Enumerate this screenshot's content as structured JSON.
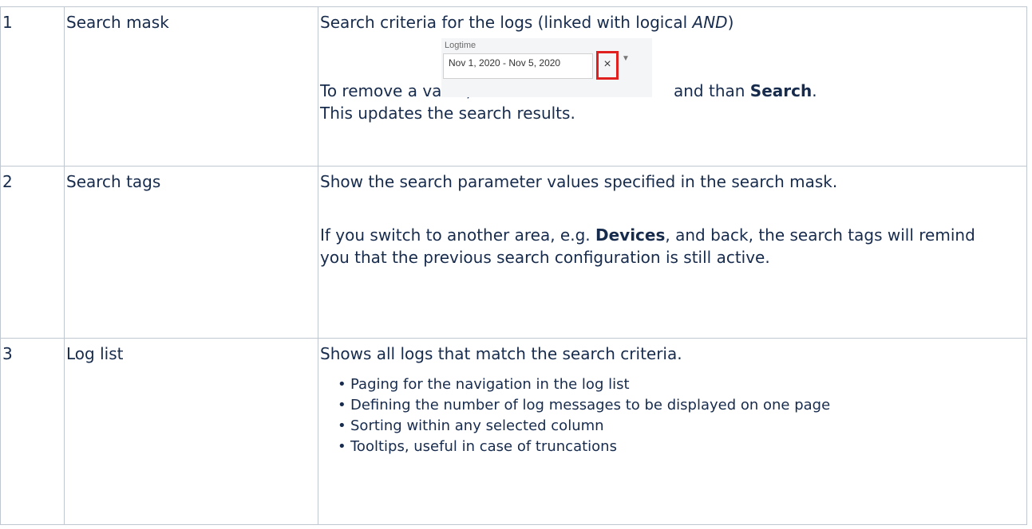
{
  "rows": [
    {
      "number": "1",
      "name": "Search mask",
      "desc_line1_pre": "Search criteria for the logs (linked with logical ",
      "desc_line1_em": "AND",
      "desc_line1_post": ")",
      "remove_pre": "To remove a value, click",
      "remove_post_pre": "and than ",
      "remove_post_bold": "Search",
      "remove_post_end": ".",
      "line3": "This updates the search results.",
      "widget": {
        "label": "Logtime",
        "value": "Nov 1, 2020 - Nov 5, 2020",
        "clear_glyph": "×",
        "dropdown_glyph": "▼",
        "highlight_color": "#e0201e"
      }
    },
    {
      "number": "2",
      "name": "Search tags",
      "desc_line1": "Show the search parameter values specified in the search mask.",
      "para2_pre": "If you switch to another area, e.g. ",
      "para2_bold": "Devices",
      "para2_post": ", and back, the search tags will remind you that the previous search configuration is still active."
    },
    {
      "number": "3",
      "name": "Log list",
      "desc_line1": "Shows all logs that match the search criteria.",
      "bullets": [
        "Paging for the navigation in the log list",
        "Defining the number of log messages to be displayed on one page",
        "Sorting within any selected column",
        "Tooltips, useful in case of truncations"
      ]
    }
  ]
}
